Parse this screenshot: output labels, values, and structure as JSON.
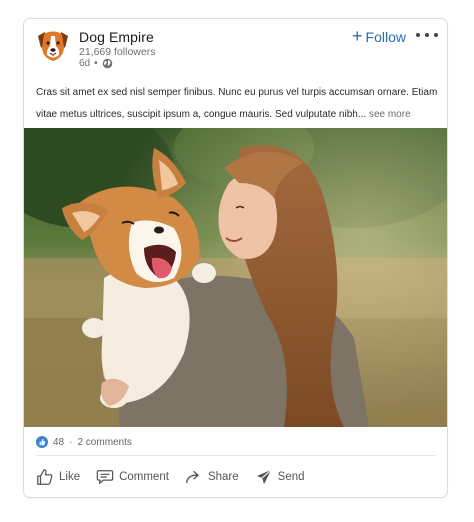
{
  "post": {
    "author": {
      "name": "Dog Empire",
      "followers": "21,669 followers",
      "age": "6d"
    },
    "follow_label": "Follow",
    "text": "Cras sit amet ex sed nisl semper finibus. Nunc eu purus vel turpis accumsan ornare. Etiam vitae metus ultrices, suscipit ipsum a, congue mauris. Sed vulputate nibh...",
    "see_more_label": "see more",
    "image_icon": "photo-woman-holding-corgi",
    "stats": {
      "likes": "48",
      "separator": "·",
      "comments": "2 comments"
    },
    "actions": [
      {
        "label": "Like",
        "icon": "thumbs-up-icon"
      },
      {
        "label": "Comment",
        "icon": "comment-icon"
      },
      {
        "label": "Share",
        "icon": "share-icon"
      },
      {
        "label": "Send",
        "icon": "send-icon"
      }
    ],
    "colors": {
      "accent": "#2a6ab8",
      "like_badge": "#3b82d6",
      "logo_orange": "#e0782a"
    }
  }
}
